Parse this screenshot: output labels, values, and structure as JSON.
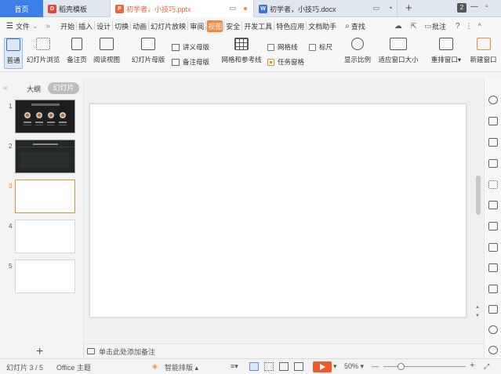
{
  "tabs": {
    "home": "首页",
    "items": [
      {
        "label": "稻壳模板",
        "icon": "docer-icon",
        "color": "#e2463a"
      },
      {
        "label": "初学者，小技巧.pptx",
        "icon": "ppt-icon",
        "color": "#e8693a",
        "active": true
      },
      {
        "label": "初学者，小技巧.docx",
        "icon": "word-icon",
        "color": "#3b73d6"
      }
    ],
    "new_tab": "+",
    "window_count": "2"
  },
  "menubar": {
    "file": "文件",
    "items": [
      "开始",
      "插入",
      "设计",
      "切换",
      "动画",
      "幻灯片放映",
      "审阅",
      "视图",
      "安全",
      "开发工具",
      "特色应用",
      "文档助手"
    ],
    "active": "视图",
    "search": "查找",
    "comment": "批注"
  },
  "ribbon": {
    "normal": "普通",
    "slide_sorter": "幻灯片浏览",
    "notes_page": "备注页",
    "reading_view": "阅读视图",
    "slide_master": "幻灯片母版",
    "handout_master": "讲义母版",
    "notes_master": "备注母版",
    "grid_guides": "网格和参考线",
    "gridlines": "网格线",
    "ruler": "标尺",
    "task_pane": "任务窗格",
    "zoom": "显示比例",
    "fit_window": "适应窗口大小",
    "arrange": "重排窗口",
    "new_window": "新建窗口"
  },
  "panel": {
    "outline_tab": "大纲",
    "slides_tab": "幻灯片",
    "slides": [
      {
        "num": "1",
        "type": "dark"
      },
      {
        "num": "2",
        "type": "dark"
      },
      {
        "num": "3",
        "type": "blank",
        "selected": true
      },
      {
        "num": "4",
        "type": "blank"
      },
      {
        "num": "5",
        "type": "blank"
      }
    ],
    "add": "+"
  },
  "notes_placeholder": "单击此处添加备注",
  "status": {
    "slide_info": "幻灯片 3 / 5",
    "theme": "Office 主题",
    "smart_layout": "智能排版",
    "zoom": "50%",
    "minus": "—",
    "plus": "+"
  }
}
